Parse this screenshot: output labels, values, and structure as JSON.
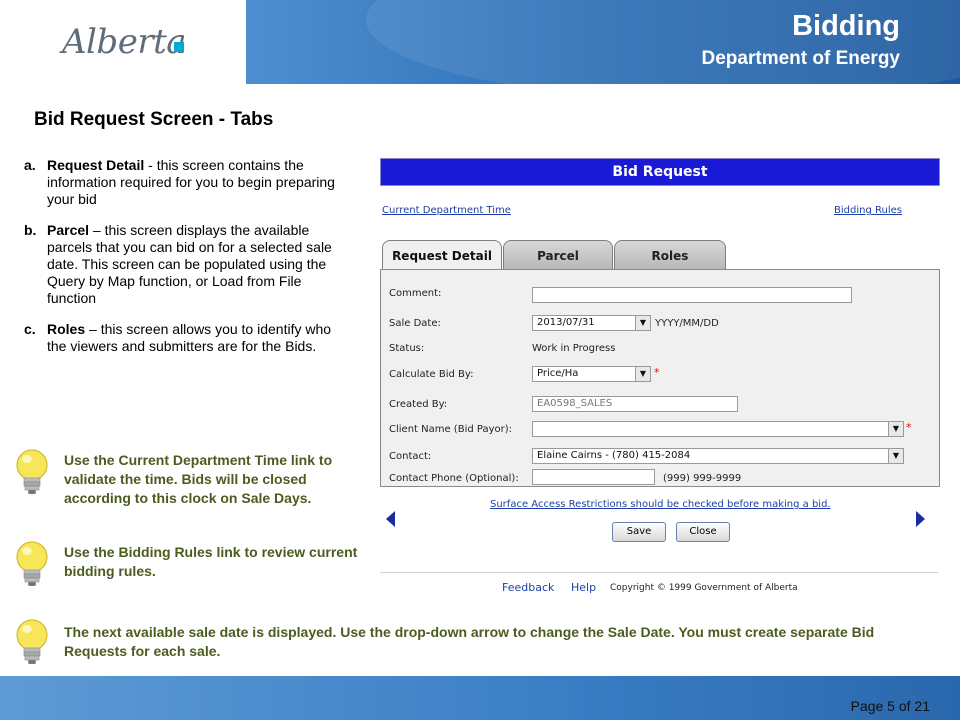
{
  "header": {
    "logo_text": "Alberta",
    "title": "Bidding",
    "subtitle": "Department of Energy"
  },
  "slide": {
    "title": "Bid Request Screen - Tabs",
    "items": [
      {
        "letter": "a.",
        "name": "Request Detail",
        "text": " - this screen contains the information required for you to begin preparing your bid"
      },
      {
        "letter": "b.",
        "name": "Parcel",
        "text": " – this screen displays the available parcels that you can bid on for a selected sale date. This screen can be populated using the Query by Map function, or Load from File function"
      },
      {
        "letter": "c.",
        "name": "Roles",
        "text": " – this screen allows you to identify who the viewers and submitters are for the Bids."
      }
    ],
    "tips": [
      "Use the Current Department Time link to validate the time. Bids will be closed according to this clock on Sale Days.",
      "Use the Bidding Rules link to review current bidding rules.",
      "The next available sale date is displayed. Use the drop-down arrow to change the Sale Date.  You must create separate Bid Requests for each sale."
    ],
    "page_number": "Page 5 of 21"
  },
  "screen": {
    "title": "Bid Request",
    "links": {
      "current_time": "Current Department Time",
      "bidding_rules": "Bidding Rules",
      "surface_access": "Surface Access Restrictions should be checked before making a bid."
    },
    "tabs": [
      {
        "label": "Request Detail",
        "active": true
      },
      {
        "label": "Parcel",
        "active": false
      },
      {
        "label": "Roles",
        "active": false
      }
    ],
    "form": {
      "comment_label": "Comment:",
      "comment_value": "",
      "sale_date_label": "Sale Date:",
      "sale_date_value": "2013/07/31",
      "sale_date_format": "YYYY/MM/DD",
      "status_label": "Status:",
      "status_value": "Work in Progress",
      "calc_label": "Calculate Bid By:",
      "calc_value": "Price/Ha",
      "created_label": "Created By:",
      "created_value": "EA0598_SALES",
      "client_label": "Client Name (Bid Payor):",
      "client_value": "",
      "contact_label": "Contact:",
      "contact_value": "Elaine Cairns - (780) 415-2084",
      "phone_label": "Contact Phone (Optional):",
      "phone_value": "",
      "phone_format": "(999) 999-9999",
      "required_mark": "*"
    },
    "buttons": {
      "save": "Save",
      "close": "Close"
    },
    "footer": {
      "feedback": "Feedback",
      "help": "Help",
      "copyright": "Copyright © 1999 Government of Alberta"
    }
  },
  "colors": {
    "header_blue": "#2f71b8",
    "screen_title_bar": "#1a1ad6",
    "tip_text": "#4b5c1f",
    "link": "#1c3fa8",
    "nav_arrow": "#1a2aa0",
    "required": "#d01010"
  }
}
